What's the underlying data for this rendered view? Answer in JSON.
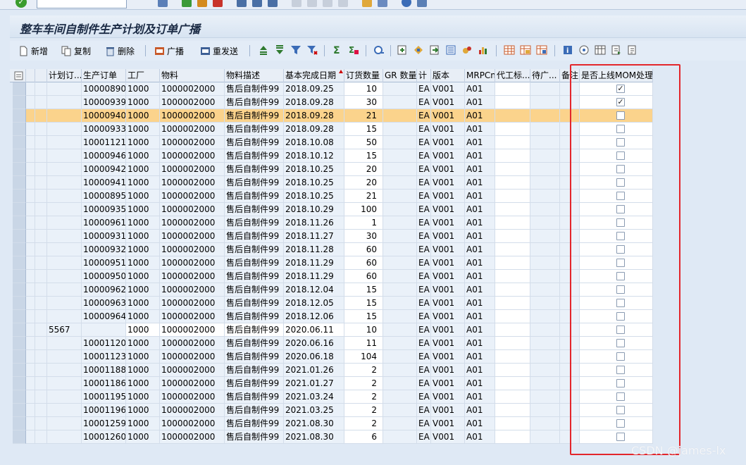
{
  "window": {
    "title": "整车车间自制件生产计划及订单广播"
  },
  "toolbar": {
    "new_label": "新增",
    "copy_label": "复制",
    "delete_label": "删除",
    "broadcast_label": "广播",
    "resend_label": "重发送"
  },
  "grid": {
    "headers": {
      "selector": "",
      "plan_order": "计划订...",
      "prod_order": "生产订单",
      "plant": "工厂",
      "material": "物料",
      "material_desc": "物料描述",
      "finish_date": "基本完成日期",
      "order_qty": "订货数量",
      "gr_qty": "GR 数量",
      "unit": "计",
      "version": "版本",
      "mrp": "MRPCn",
      "agent": "代工标...",
      "pending": "待广...",
      "remark": "备注",
      "mom": "是否上线MOM处理"
    },
    "rows": [
      {
        "plan": "",
        "order": "10000890",
        "plant": "1000",
        "material": "1000002000",
        "desc": "售后自制件99",
        "date": "2018.09.25",
        "qty": "10",
        "gr": "",
        "unit": "EA",
        "version": "V001",
        "mrp": "A01",
        "mom": "✓"
      },
      {
        "plan": "",
        "order": "10000939",
        "plant": "1000",
        "material": "1000002000",
        "desc": "售后自制件99",
        "date": "2018.09.28",
        "qty": "30",
        "gr": "",
        "unit": "EA",
        "version": "V001",
        "mrp": "A01",
        "mom": "✓"
      },
      {
        "plan": "",
        "order": "10000940",
        "plant": "1000",
        "material": "1000002000",
        "desc": "售后自制件99",
        "date": "2018.09.28",
        "qty": "21",
        "gr": "",
        "unit": "EA",
        "version": "V001",
        "mrp": "A01",
        "mom": ""
      },
      {
        "plan": "",
        "order": "10000933",
        "plant": "1000",
        "material": "1000002000",
        "desc": "售后自制件99",
        "date": "2018.09.28",
        "qty": "15",
        "gr": "",
        "unit": "EA",
        "version": "V001",
        "mrp": "A01",
        "mom": ""
      },
      {
        "plan": "",
        "order": "10001121",
        "plant": "1000",
        "material": "1000002000",
        "desc": "售后自制件99",
        "date": "2018.10.08",
        "qty": "50",
        "gr": "",
        "unit": "EA",
        "version": "V001",
        "mrp": "A01",
        "mom": ""
      },
      {
        "plan": "",
        "order": "10000946",
        "plant": "1000",
        "material": "1000002000",
        "desc": "售后自制件99",
        "date": "2018.10.12",
        "qty": "15",
        "gr": "",
        "unit": "EA",
        "version": "V001",
        "mrp": "A01",
        "mom": ""
      },
      {
        "plan": "",
        "order": "10000942",
        "plant": "1000",
        "material": "1000002000",
        "desc": "售后自制件99",
        "date": "2018.10.25",
        "qty": "20",
        "gr": "",
        "unit": "EA",
        "version": "V001",
        "mrp": "A01",
        "mom": ""
      },
      {
        "plan": "",
        "order": "10000941",
        "plant": "1000",
        "material": "1000002000",
        "desc": "售后自制件99",
        "date": "2018.10.25",
        "qty": "20",
        "gr": "",
        "unit": "EA",
        "version": "V001",
        "mrp": "A01",
        "mom": ""
      },
      {
        "plan": "",
        "order": "10000895",
        "plant": "1000",
        "material": "1000002000",
        "desc": "售后自制件99",
        "date": "2018.10.25",
        "qty": "21",
        "gr": "",
        "unit": "EA",
        "version": "V001",
        "mrp": "A01",
        "mom": ""
      },
      {
        "plan": "",
        "order": "10000935",
        "plant": "1000",
        "material": "1000002000",
        "desc": "售后自制件99",
        "date": "2018.10.29",
        "qty": "100",
        "gr": "",
        "unit": "EA",
        "version": "V001",
        "mrp": "A01",
        "mom": ""
      },
      {
        "plan": "",
        "order": "10000961",
        "plant": "1000",
        "material": "1000002000",
        "desc": "售后自制件99",
        "date": "2018.11.26",
        "qty": "1",
        "gr": "",
        "unit": "EA",
        "version": "V001",
        "mrp": "A01",
        "mom": ""
      },
      {
        "plan": "",
        "order": "10000931",
        "plant": "1000",
        "material": "1000002000",
        "desc": "售后自制件99",
        "date": "2018.11.27",
        "qty": "30",
        "gr": "",
        "unit": "EA",
        "version": "V001",
        "mrp": "A01",
        "mom": ""
      },
      {
        "plan": "",
        "order": "10000932",
        "plant": "1000",
        "material": "1000002000",
        "desc": "售后自制件99",
        "date": "2018.11.28",
        "qty": "60",
        "gr": "",
        "unit": "EA",
        "version": "V001",
        "mrp": "A01",
        "mom": ""
      },
      {
        "plan": "",
        "order": "10000951",
        "plant": "1000",
        "material": "1000002000",
        "desc": "售后自制件99",
        "date": "2018.11.29",
        "qty": "60",
        "gr": "",
        "unit": "EA",
        "version": "V001",
        "mrp": "A01",
        "mom": ""
      },
      {
        "plan": "",
        "order": "10000950",
        "plant": "1000",
        "material": "1000002000",
        "desc": "售后自制件99",
        "date": "2018.11.29",
        "qty": "60",
        "gr": "",
        "unit": "EA",
        "version": "V001",
        "mrp": "A01",
        "mom": ""
      },
      {
        "plan": "",
        "order": "10000962",
        "plant": "1000",
        "material": "1000002000",
        "desc": "售后自制件99",
        "date": "2018.12.04",
        "qty": "15",
        "gr": "",
        "unit": "EA",
        "version": "V001",
        "mrp": "A01",
        "mom": ""
      },
      {
        "plan": "",
        "order": "10000963",
        "plant": "1000",
        "material": "1000002000",
        "desc": "售后自制件99",
        "date": "2018.12.05",
        "qty": "15",
        "gr": "",
        "unit": "EA",
        "version": "V001",
        "mrp": "A01",
        "mom": ""
      },
      {
        "plan": "",
        "order": "10000964",
        "plant": "1000",
        "material": "1000002000",
        "desc": "售后自制件99",
        "date": "2018.12.06",
        "qty": "15",
        "gr": "",
        "unit": "EA",
        "version": "V001",
        "mrp": "A01",
        "mom": ""
      },
      {
        "plan": "5567",
        "order": "",
        "plant": "1000",
        "material": "1000002000",
        "desc": "售后自制件99",
        "date": "2020.06.11",
        "qty": "10",
        "gr": "",
        "unit": "EA",
        "version": "V001",
        "mrp": "A01",
        "mom": ""
      },
      {
        "plan": "",
        "order": "10001120",
        "plant": "1000",
        "material": "1000002000",
        "desc": "售后自制件99",
        "date": "2020.06.16",
        "qty": "11",
        "gr": "",
        "unit": "EA",
        "version": "V001",
        "mrp": "A01",
        "mom": ""
      },
      {
        "plan": "",
        "order": "10001123",
        "plant": "1000",
        "material": "1000002000",
        "desc": "售后自制件99",
        "date": "2020.06.18",
        "qty": "104",
        "gr": "",
        "unit": "EA",
        "version": "V001",
        "mrp": "A01",
        "mom": ""
      },
      {
        "plan": "",
        "order": "10001188",
        "plant": "1000",
        "material": "1000002000",
        "desc": "售后自制件99",
        "date": "2021.01.26",
        "qty": "2",
        "gr": "",
        "unit": "EA",
        "version": "V001",
        "mrp": "A01",
        "mom": ""
      },
      {
        "plan": "",
        "order": "10001186",
        "plant": "1000",
        "material": "1000002000",
        "desc": "售后自制件99",
        "date": "2021.01.27",
        "qty": "2",
        "gr": "",
        "unit": "EA",
        "version": "V001",
        "mrp": "A01",
        "mom": ""
      },
      {
        "plan": "",
        "order": "10001195",
        "plant": "1000",
        "material": "1000002000",
        "desc": "售后自制件99",
        "date": "2021.03.24",
        "qty": "2",
        "gr": "",
        "unit": "EA",
        "version": "V001",
        "mrp": "A01",
        "mom": ""
      },
      {
        "plan": "",
        "order": "10001196",
        "plant": "1000",
        "material": "1000002000",
        "desc": "售后自制件99",
        "date": "2021.03.25",
        "qty": "2",
        "gr": "",
        "unit": "EA",
        "version": "V001",
        "mrp": "A01",
        "mom": ""
      },
      {
        "plan": "",
        "order": "10001259",
        "plant": "1000",
        "material": "1000002000",
        "desc": "售后自制件99",
        "date": "2021.08.30",
        "qty": "2",
        "gr": "",
        "unit": "EA",
        "version": "V001",
        "mrp": "A01",
        "mom": ""
      },
      {
        "plan": "",
        "order": "10001260",
        "plant": "1000",
        "material": "1000002000",
        "desc": "售后自制件99",
        "date": "2021.08.30",
        "qty": "6",
        "gr": "",
        "unit": "EA",
        "version": "V001",
        "mrp": "A01",
        "mom": ""
      }
    ],
    "highlighted_row": 2
  },
  "watermark": "CSDN @james-lx",
  "colors": {
    "highlight": "#fbd38c",
    "annotation_box": "#e3262b"
  }
}
